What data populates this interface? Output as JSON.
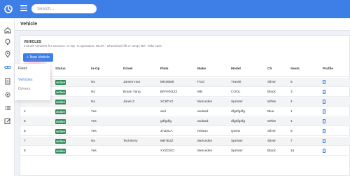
{
  "header": {
    "search_placeholder": "Search..."
  },
  "page": {
    "title": "Vehicle"
  },
  "card": {
    "title": "VEHICLES",
    "description": "Include vehicles for services. In-Op -in operation; WL/R - wheelchair lift or ramp; BR - bike rack.",
    "new_button": "+ New Vehicle"
  },
  "flyout": {
    "heading": "Fleet",
    "items": [
      "Vehicles",
      "Drivers"
    ]
  },
  "table": {
    "headers": [
      "",
      "Status",
      "In-Op",
      "Driver",
      "Plate",
      "Make",
      "Model",
      "Clr",
      "Seats",
      "Profile"
    ],
    "rows": [
      {
        "num": "",
        "status": "Active",
        "inop": "No",
        "driver": "James Hue",
        "plate": "MN36M8",
        "make": "Ford",
        "model": "Transit",
        "clr": "Silver",
        "seats": "5"
      },
      {
        "num": "",
        "status": "Active",
        "inop": "No",
        "driver": "Bryan Yang",
        "plate": "BRYAN123",
        "make": "MB",
        "model": "COOL",
        "clr": "Black",
        "seats": "3"
      },
      {
        "num": "",
        "status": "Active",
        "inop": "No",
        "driver": "Janet Z",
        "plate": "XC9TV2",
        "make": "Mercedes",
        "model": "Sprinter",
        "clr": "White",
        "seats": "4"
      },
      {
        "num": "4",
        "status": "Active",
        "inop": "Yes",
        "driver": "",
        "plate": "asd",
        "make": "asdasd",
        "model": "dfgdfgdfg",
        "clr": "Blue",
        "seats": "1"
      },
      {
        "num": "5",
        "status": "Active",
        "inop": "Yes",
        "driver": "",
        "plate": "gdfgdfg",
        "make": "asdasd",
        "model": "dfgdfgdfg",
        "clr": "White",
        "seats": "1"
      },
      {
        "num": "6",
        "status": "Active",
        "inop": "Yes",
        "driver": "",
        "plate": "JHJ3CA",
        "make": "Nissan",
        "model": "Quest",
        "clr": "Silver",
        "seats": "6"
      },
      {
        "num": "7",
        "status": "Active",
        "inop": "No",
        "driver": "Ted Berry",
        "plate": "MB7BJZ",
        "make": "Mercedes",
        "model": "Sprinter",
        "clr": "Silver",
        "seats": "7"
      },
      {
        "num": "8",
        "status": "Active",
        "inop": "Yes",
        "driver": "",
        "plate": "XYZOSO",
        "make": "Mercedes",
        "model": "Sprinter",
        "clr": "Black",
        "seats": "15"
      }
    ]
  },
  "sidebar": {
    "icons": [
      "home-icon",
      "bulb-icon",
      "pin-icon",
      "link-icon",
      "documents-icon",
      "gear-icon",
      "list-icon",
      "edit-icon"
    ]
  },
  "colors": {
    "primary": "#3d7fe6",
    "active_badge": "#2e8b57"
  }
}
